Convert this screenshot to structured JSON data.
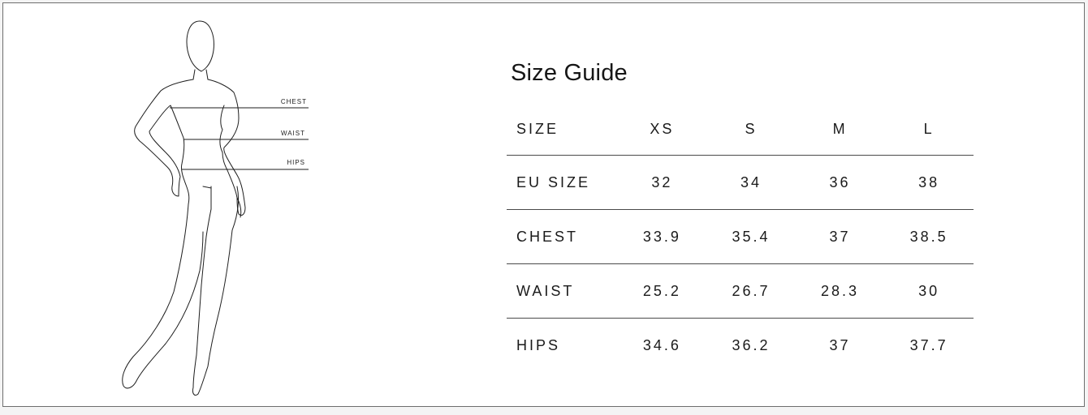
{
  "title": "Size Guide",
  "figure": {
    "labels": {
      "chest": "CHEST",
      "waist": "WAIST",
      "hips": "HIPS"
    }
  },
  "table": {
    "header": {
      "label": "SIZE",
      "values": [
        "XS",
        "S",
        "M",
        "L"
      ]
    },
    "rows": [
      {
        "label": "EU SIZE",
        "values": [
          "32",
          "34",
          "36",
          "38"
        ]
      },
      {
        "label": "CHEST",
        "values": [
          "33.9",
          "35.4",
          "37",
          "38.5"
        ]
      },
      {
        "label": "WAIST",
        "values": [
          "25.2",
          "26.7",
          "28.3",
          "30"
        ]
      },
      {
        "label": "HIPS",
        "values": [
          "34.6",
          "36.2",
          "37",
          "37.7"
        ]
      }
    ]
  }
}
